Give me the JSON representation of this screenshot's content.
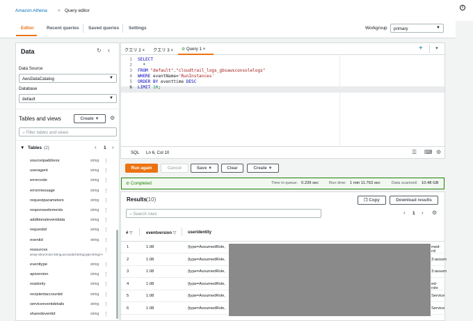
{
  "breadcrumb": {
    "service": "Amazon Athena",
    "sep": ">",
    "page": "Query editor"
  },
  "info_icon": "i",
  "tabs": [
    {
      "label": "Editor"
    },
    {
      "label": "Recent queries"
    },
    {
      "label": "Saved queries"
    },
    {
      "label": "Settings"
    }
  ],
  "workgroup": {
    "label": "Workgroup",
    "value": "primary"
  },
  "data_panel": {
    "title": "Data",
    "source_label": "Data Source",
    "source_value": "AwsDataCatalog",
    "database_label": "Database",
    "database_value": "default",
    "tables_title": "Tables and views",
    "create_label": "Create",
    "filter_placeholder": "Filter tables and views",
    "tables_label": "Tables",
    "tables_count": "(2)",
    "page": "1"
  },
  "columns": [
    {
      "name": "sourceipaddress",
      "type": "string"
    },
    {
      "name": "useragent",
      "type": "string"
    },
    {
      "name": "errorcode",
      "type": "string"
    },
    {
      "name": "errormessage",
      "type": "string"
    },
    {
      "name": "requestparameters",
      "type": "string"
    },
    {
      "name": "responseelements",
      "type": "string"
    },
    {
      "name": "additionaleventdata",
      "type": "string"
    },
    {
      "name": "requestid",
      "type": "string"
    },
    {
      "name": "eventid",
      "type": "string"
    },
    {
      "name": "resources",
      "type": "array<struct<arn:string,accountid:string,type:string>>"
    },
    {
      "name": "eventtype",
      "type": "string"
    },
    {
      "name": "apiversion",
      "type": "string"
    },
    {
      "name": "readonly",
      "type": "string"
    },
    {
      "name": "recipientaccountid",
      "type": "string"
    },
    {
      "name": "serviceeventdetails",
      "type": "string"
    },
    {
      "name": "sharedeventid",
      "type": "string"
    }
  ],
  "query_tabs": [
    {
      "label": "クエリ 2"
    },
    {
      "label": "クエリ 3"
    },
    {
      "label": "Query 1"
    }
  ],
  "code_lines": [
    "SELECT",
    "  *",
    "FROM \"default\".\"cloudtrail_logs_gbsawsconsolelogs\"",
    "WHERE eventName='RunInstances'",
    "ORDER BY eventtime DESC",
    "LIMIT 10;"
  ],
  "editor_status": {
    "lang": "SQL",
    "pos": "Ln 6, Col 10"
  },
  "actions": {
    "run": "Run again",
    "cancel": "Cancel",
    "save": "Save",
    "clear": "Clear",
    "create": "Create"
  },
  "status": {
    "state": "Completed",
    "queue_label": "Time in queue:",
    "queue_value": "0.239 sec",
    "run_label": "Run time:",
    "run_value": "1 min 11.763 sec",
    "scanned_label": "Data scanned:",
    "scanned_value": "10.48 GB"
  },
  "results": {
    "title": "Results",
    "count": "(10)",
    "copy": "Copy",
    "download": "Download results",
    "search_placeholder": "Search rows",
    "page": "1",
    "headers": [
      "#",
      "eventversion",
      "useridentity"
    ]
  },
  "rows": [
    {
      "n": "1",
      "ver": "1.08",
      "uid": "{type=AssumedRole,",
      "tail": "med-rol"
    },
    {
      "n": "2",
      "ver": "1.08",
      "uid": "{type=AssumedRole,",
      "tail": "3:assum"
    },
    {
      "n": "3",
      "ver": "1.08",
      "uid": "{type=AssumedRole,",
      "tail": "3:assum"
    },
    {
      "n": "4",
      "ver": "1.08",
      "uid": "{type=AssumedRole,",
      "tail": "ed-role"
    },
    {
      "n": "5",
      "ver": "1.08",
      "uid": "{type=AssumedRole,",
      "tail": "Service"
    },
    {
      "n": "6",
      "ver": "1.08",
      "uid": "{type=AssumedRole,",
      "tail": "Service"
    }
  ],
  "colors": {
    "accent": "#ec7211",
    "link": "#0073bb",
    "success": "#1d8102"
  }
}
